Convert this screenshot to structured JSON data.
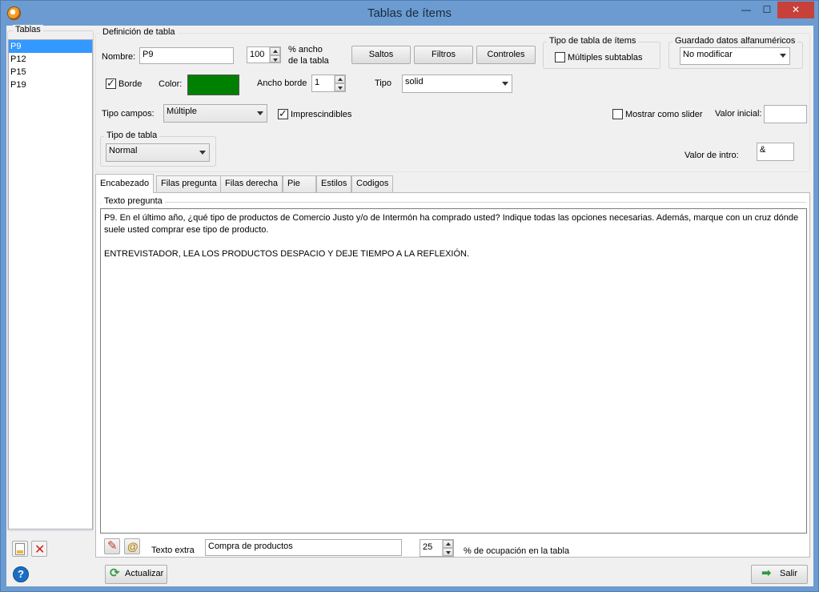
{
  "window": {
    "title": "Tablas de ítems",
    "minimize": "—",
    "maximize": "☐",
    "close": "✕"
  },
  "left": {
    "group_label": "Tablas",
    "items": [
      "P9",
      "P12",
      "P15",
      "P19"
    ]
  },
  "def": {
    "group_label": "Definición de tabla",
    "nombre_label": "Nombre:",
    "nombre_value": "P9",
    "width_value": "100",
    "width_label_1": "% ancho",
    "width_label_2": "de la tabla",
    "saltos": "Saltos",
    "filtros": "Filtros",
    "controles": "Controles",
    "tipo_tabla_items_label": "Tipo de tabla de ítems",
    "multiples_label": "Múltiples subtablas",
    "guardado_label": "Guardado datos alfanuméricos",
    "guardado_value": "No modificar",
    "borde_label": "Borde",
    "color_label": "Color:",
    "color_value": "#008000",
    "ancho_borde_label": "Ancho borde",
    "ancho_borde_value": "1",
    "tipo_label": "Tipo",
    "tipo_value": "solid",
    "tipo_campos_label": "Tipo campos:",
    "tipo_campos_value": "Múltiple",
    "imprescindibles_label": "Imprescindibles",
    "slider_label": "Mostrar como slider",
    "valor_inicial_label": "Valor inicial:",
    "valor_inicial_value": "",
    "tipo_de_tabla_label": "Tipo de tabla",
    "tipo_de_tabla_value": "Normal",
    "valor_intro_label": "Valor  de intro:",
    "valor_intro_value": "&"
  },
  "tabs": [
    "Encabezado",
    "Filas pregunta",
    "Filas derecha",
    "Pie",
    "Estilos",
    "Codigos"
  ],
  "panel": {
    "texto_label": "Texto pregunta",
    "texto_value": "P9. En el último año, ¿qué tipo de productos de Comercio Justo y/o de Intermón ha comprado usted? Indique todas las opciones necesarias. Además, marque con un cruz dónde suele usted comprar ese tipo de producto.\n\nENTREVISTADOR, LEA LOS PRODUCTOS DESPACIO Y DEJE TIEMPO A LA REFLEXIÓN.",
    "extra_label": "Texto extra",
    "extra_value": "Compra de productos",
    "ocupacion_value": "25",
    "ocupacion_label": "% de ocupación en la tabla"
  },
  "footer": {
    "actualizar": "Actualizar",
    "salir": "Salir",
    "help_glyph": "?"
  }
}
